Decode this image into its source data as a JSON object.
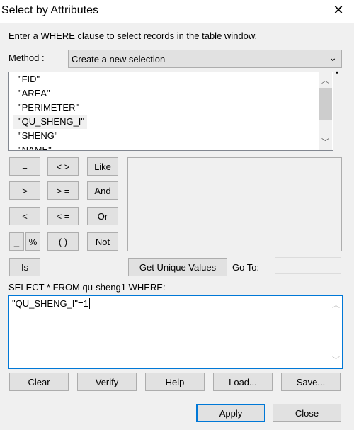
{
  "window": {
    "title": "Select by Attributes",
    "close_icon": "close-icon"
  },
  "instruction": "Enter a WHERE clause to select records in the table window.",
  "method": {
    "label": "Method :",
    "value": "Create a new selection"
  },
  "fields": [
    "\"FID\"",
    "\"AREA\"",
    "\"PERIMETER\"",
    "\"QU_SHENG_I\"",
    "\"SHENG\"",
    "\"NAME\""
  ],
  "selected_field": "\"QU_SHENG_I\"",
  "operators": {
    "eq": "=",
    "ne": "< >",
    "like": "Like",
    "gt": ">",
    "ge": "> =",
    "and": "And",
    "lt": "<",
    "le": "< =",
    "or": "Or",
    "underscore": "_",
    "percent": "%",
    "parens": "( )",
    "not": "Not",
    "is": "Is"
  },
  "get_unique_values": "Get Unique Values",
  "goto_label": "Go To:",
  "goto_value": "",
  "select_label": "SELECT * FROM qu-sheng1 WHERE:",
  "expression": "\"QU_SHENG_I\"=1",
  "actions": {
    "clear": "Clear",
    "verify": "Verify",
    "help": "Help",
    "load": "Load...",
    "save": "Save..."
  },
  "footer": {
    "apply": "Apply",
    "close": "Close"
  }
}
